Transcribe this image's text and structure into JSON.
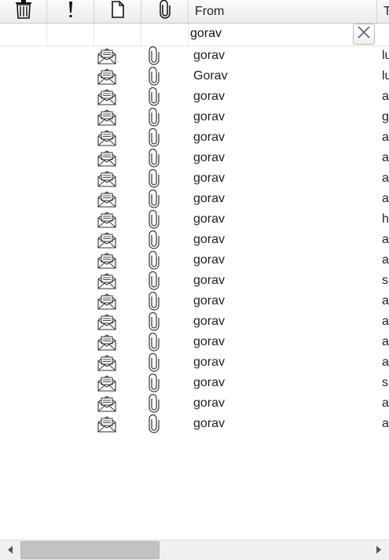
{
  "header": {
    "columns": [
      {
        "icon": "trash-icon"
      },
      {
        "icon": "priority-icon"
      },
      {
        "icon": "document-icon"
      },
      {
        "icon": "attachment-icon"
      },
      {
        "label": "From"
      },
      {
        "label": "T"
      }
    ]
  },
  "filter": {
    "from_value": "gorav"
  },
  "rows": [
    {
      "from": "gorav",
      "to": "lu"
    },
    {
      "from": "Gorav",
      "to": "lu"
    },
    {
      "from": "gorav",
      "to": "a"
    },
    {
      "from": "gorav",
      "to": "g"
    },
    {
      "from": "gorav",
      "to": "a"
    },
    {
      "from": "gorav",
      "to": "a"
    },
    {
      "from": "gorav",
      "to": "a"
    },
    {
      "from": "gorav",
      "to": "a"
    },
    {
      "from": "gorav",
      "to": "h"
    },
    {
      "from": "gorav",
      "to": "a"
    },
    {
      "from": "gorav",
      "to": "a"
    },
    {
      "from": "gorav",
      "to": "s"
    },
    {
      "from": "gorav",
      "to": "a"
    },
    {
      "from": "gorav",
      "to": "a"
    },
    {
      "from": "gorav",
      "to": "a"
    },
    {
      "from": "gorav",
      "to": "a"
    },
    {
      "from": "gorav",
      "to": "s"
    },
    {
      "from": "gorav",
      "to": "a"
    },
    {
      "from": "gorav",
      "to": "a"
    }
  ],
  "scrollbar": {
    "horizontal_position": 0.0,
    "visible_fraction": 0.4
  }
}
